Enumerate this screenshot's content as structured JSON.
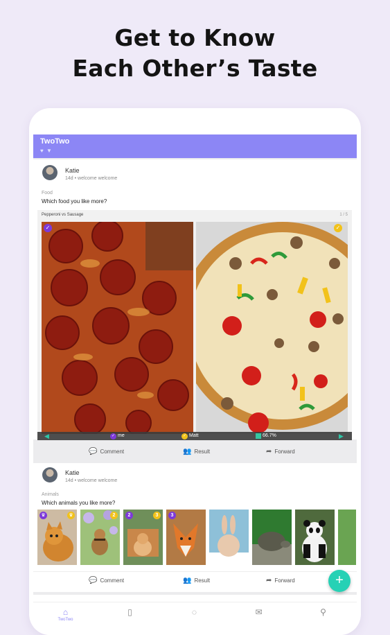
{
  "headline": {
    "line1": "Get to Know",
    "line2": "Each Other’s Taste"
  },
  "app": {
    "title": "TwoTwo",
    "subicons": "♥ ▼",
    "accent": "#8c86f5",
    "teal": "#26d1b5"
  },
  "posts": [
    {
      "username": "Katie",
      "meta": "14d • welcome welcome",
      "category": "Food",
      "question": "Which food you like more?",
      "vote_title": "Pepperoni vs Sausage",
      "vote_page": "1 / 5",
      "results": {
        "voter1": "me",
        "voter2": "Matt",
        "percent": "66.7%"
      },
      "actions": {
        "comment": "Comment",
        "result": "Result",
        "forward": "Forward"
      }
    },
    {
      "username": "Katie",
      "meta": "14d • welcome welcome",
      "category": "Animals",
      "question": "Which animals you like more?",
      "thumbs": [
        {
          "name": "cat",
          "badge_left": "♛",
          "badge_right": "♛"
        },
        {
          "name": "chipmunk",
          "badge_left": "",
          "badge_right": "2"
        },
        {
          "name": "hamster",
          "badge_left": "2",
          "badge_right": "3"
        },
        {
          "name": "fox",
          "badge_left": "3",
          "badge_right": ""
        },
        {
          "name": "rabbit",
          "badge_left": "",
          "badge_right": ""
        },
        {
          "name": "tortoise",
          "badge_left": "",
          "badge_right": ""
        },
        {
          "name": "panda",
          "badge_left": "",
          "badge_right": ""
        }
      ],
      "actions": {
        "comment": "Comment",
        "result": "Result",
        "forward": "Forward"
      }
    }
  ],
  "fab": "+",
  "nav": [
    {
      "icon": "home-icon",
      "label": "TwoTwo",
      "active": true
    },
    {
      "icon": "book-icon",
      "label": "",
      "active": false
    },
    {
      "icon": "chat-icon",
      "label": "",
      "active": false
    },
    {
      "icon": "mail-icon",
      "label": "",
      "active": false
    },
    {
      "icon": "profile-icon",
      "label": "",
      "active": false
    }
  ]
}
